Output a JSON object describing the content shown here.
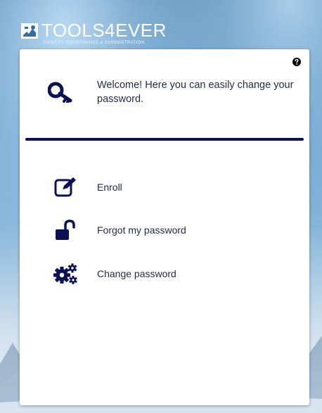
{
  "brand": {
    "title": "TOOLS4EVER",
    "subtitle": "IDENTITY GOVERNANCE & ADMINISTRATION"
  },
  "header": {
    "welcome_text": "Welcome! Here you can easily change your password.",
    "help_icon": "question-circle-icon",
    "welcome_icon": "key-icon"
  },
  "menu": {
    "items": [
      {
        "label": "Enroll",
        "icon": "edit-icon"
      },
      {
        "label": "Forgot my password",
        "icon": "unlock-icon"
      },
      {
        "label": "Change password",
        "icon": "gears-icon"
      }
    ]
  },
  "colors": {
    "accent": "#0c1055",
    "text": "#1f2a44",
    "card": "#ffffff"
  }
}
